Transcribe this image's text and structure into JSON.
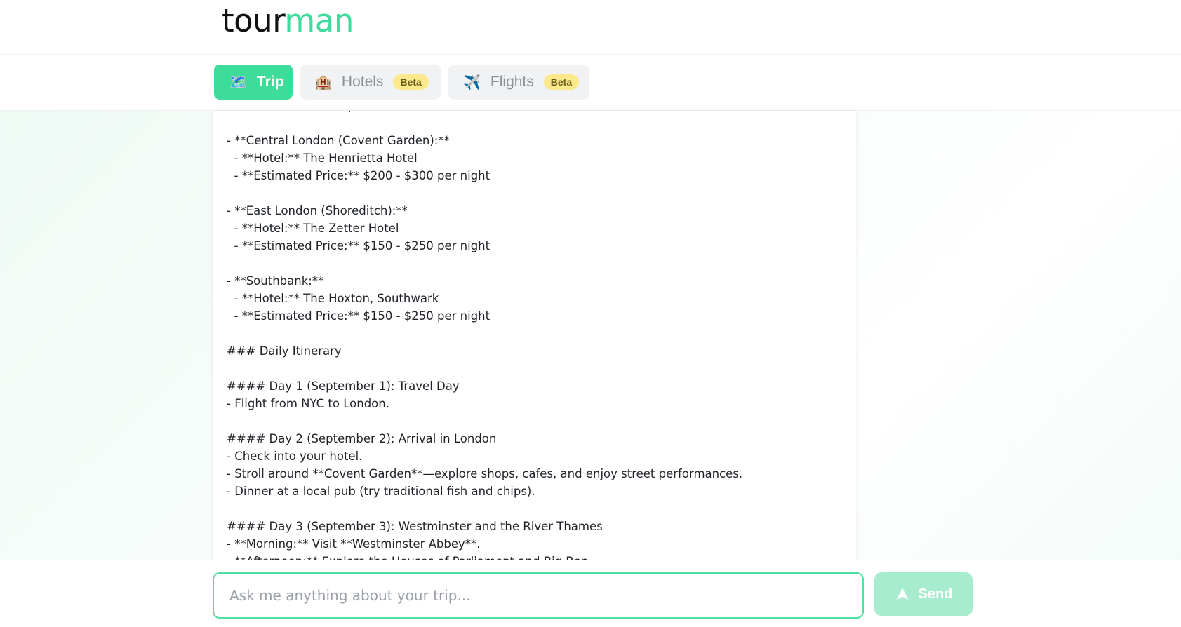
{
  "brand": {
    "part1": "tour",
    "part2": "man"
  },
  "tabs": [
    {
      "icon": "🗺️",
      "label": "Trip",
      "badge": ""
    },
    {
      "icon": "🏨",
      "label": "Hotels",
      "badge": "Beta"
    },
    {
      "icon": "✈️",
      "label": "Flights",
      "badge": "Beta"
    }
  ],
  "itinerary_lines": [
    "    Accommodation Options",
    "",
    "- **Central London (Covent Garden):**",
    "  - **Hotel:** The Henrietta Hotel",
    "  - **Estimated Price:** $200 - $300 per night",
    "",
    "- **East London (Shoreditch):**",
    "  - **Hotel:** The Zetter Hotel",
    "  - **Estimated Price:** $150 - $250 per night",
    "",
    "- **Southbank:**",
    "  - **Hotel:** The Hoxton, Southwark",
    "  - **Estimated Price:** $150 - $250 per night",
    "",
    "### Daily Itinerary",
    "",
    "#### Day 1 (September 1): Travel Day",
    "- Flight from NYC to London.",
    "",
    "#### Day 2 (September 2): Arrival in London",
    "- Check into your hotel.",
    "- Stroll around **Covent Garden**—explore shops, cafes, and enjoy street performances.",
    "- Dinner at a local pub (try traditional fish and chips).",
    "",
    "#### Day 3 (September 3): Westminster and the River Thames",
    "- **Morning:** Visit **Westminster Abbey**.",
    "- **Afternoon:** Explore the Houses of Parliament and Big Ben."
  ],
  "chat": {
    "placeholder": "Ask me anything about your trip...",
    "send_label": "Send"
  },
  "colors": {
    "accent": "#3ddc9a",
    "send_disabled": "#a8ecd0",
    "badge": "#fbe98c"
  }
}
